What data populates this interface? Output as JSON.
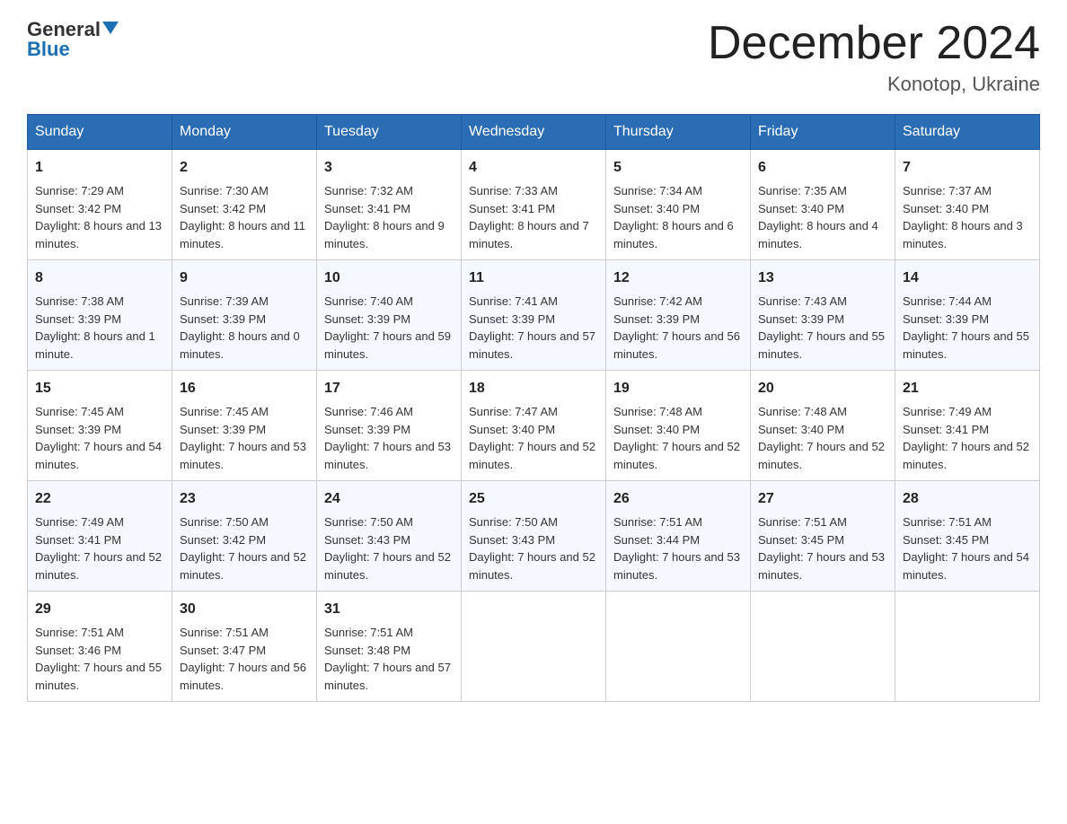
{
  "header": {
    "logo_general": "General",
    "logo_blue": "Blue",
    "month_title": "December 2024",
    "location": "Konotop, Ukraine"
  },
  "days_of_week": [
    "Sunday",
    "Monday",
    "Tuesday",
    "Wednesday",
    "Thursday",
    "Friday",
    "Saturday"
  ],
  "weeks": [
    [
      {
        "day": "1",
        "sunrise": "7:29 AM",
        "sunset": "3:42 PM",
        "daylight": "8 hours and 13 minutes."
      },
      {
        "day": "2",
        "sunrise": "7:30 AM",
        "sunset": "3:42 PM",
        "daylight": "8 hours and 11 minutes."
      },
      {
        "day": "3",
        "sunrise": "7:32 AM",
        "sunset": "3:41 PM",
        "daylight": "8 hours and 9 minutes."
      },
      {
        "day": "4",
        "sunrise": "7:33 AM",
        "sunset": "3:41 PM",
        "daylight": "8 hours and 7 minutes."
      },
      {
        "day": "5",
        "sunrise": "7:34 AM",
        "sunset": "3:40 PM",
        "daylight": "8 hours and 6 minutes."
      },
      {
        "day": "6",
        "sunrise": "7:35 AM",
        "sunset": "3:40 PM",
        "daylight": "8 hours and 4 minutes."
      },
      {
        "day": "7",
        "sunrise": "7:37 AM",
        "sunset": "3:40 PM",
        "daylight": "8 hours and 3 minutes."
      }
    ],
    [
      {
        "day": "8",
        "sunrise": "7:38 AM",
        "sunset": "3:39 PM",
        "daylight": "8 hours and 1 minute."
      },
      {
        "day": "9",
        "sunrise": "7:39 AM",
        "sunset": "3:39 PM",
        "daylight": "8 hours and 0 minutes."
      },
      {
        "day": "10",
        "sunrise": "7:40 AM",
        "sunset": "3:39 PM",
        "daylight": "7 hours and 59 minutes."
      },
      {
        "day": "11",
        "sunrise": "7:41 AM",
        "sunset": "3:39 PM",
        "daylight": "7 hours and 57 minutes."
      },
      {
        "day": "12",
        "sunrise": "7:42 AM",
        "sunset": "3:39 PM",
        "daylight": "7 hours and 56 minutes."
      },
      {
        "day": "13",
        "sunrise": "7:43 AM",
        "sunset": "3:39 PM",
        "daylight": "7 hours and 55 minutes."
      },
      {
        "day": "14",
        "sunrise": "7:44 AM",
        "sunset": "3:39 PM",
        "daylight": "7 hours and 55 minutes."
      }
    ],
    [
      {
        "day": "15",
        "sunrise": "7:45 AM",
        "sunset": "3:39 PM",
        "daylight": "7 hours and 54 minutes."
      },
      {
        "day": "16",
        "sunrise": "7:45 AM",
        "sunset": "3:39 PM",
        "daylight": "7 hours and 53 minutes."
      },
      {
        "day": "17",
        "sunrise": "7:46 AM",
        "sunset": "3:39 PM",
        "daylight": "7 hours and 53 minutes."
      },
      {
        "day": "18",
        "sunrise": "7:47 AM",
        "sunset": "3:40 PM",
        "daylight": "7 hours and 52 minutes."
      },
      {
        "day": "19",
        "sunrise": "7:48 AM",
        "sunset": "3:40 PM",
        "daylight": "7 hours and 52 minutes."
      },
      {
        "day": "20",
        "sunrise": "7:48 AM",
        "sunset": "3:40 PM",
        "daylight": "7 hours and 52 minutes."
      },
      {
        "day": "21",
        "sunrise": "7:49 AM",
        "sunset": "3:41 PM",
        "daylight": "7 hours and 52 minutes."
      }
    ],
    [
      {
        "day": "22",
        "sunrise": "7:49 AM",
        "sunset": "3:41 PM",
        "daylight": "7 hours and 52 minutes."
      },
      {
        "day": "23",
        "sunrise": "7:50 AM",
        "sunset": "3:42 PM",
        "daylight": "7 hours and 52 minutes."
      },
      {
        "day": "24",
        "sunrise": "7:50 AM",
        "sunset": "3:43 PM",
        "daylight": "7 hours and 52 minutes."
      },
      {
        "day": "25",
        "sunrise": "7:50 AM",
        "sunset": "3:43 PM",
        "daylight": "7 hours and 52 minutes."
      },
      {
        "day": "26",
        "sunrise": "7:51 AM",
        "sunset": "3:44 PM",
        "daylight": "7 hours and 53 minutes."
      },
      {
        "day": "27",
        "sunrise": "7:51 AM",
        "sunset": "3:45 PM",
        "daylight": "7 hours and 53 minutes."
      },
      {
        "day": "28",
        "sunrise": "7:51 AM",
        "sunset": "3:45 PM",
        "daylight": "7 hours and 54 minutes."
      }
    ],
    [
      {
        "day": "29",
        "sunrise": "7:51 AM",
        "sunset": "3:46 PM",
        "daylight": "7 hours and 55 minutes."
      },
      {
        "day": "30",
        "sunrise": "7:51 AM",
        "sunset": "3:47 PM",
        "daylight": "7 hours and 56 minutes."
      },
      {
        "day": "31",
        "sunrise": "7:51 AM",
        "sunset": "3:48 PM",
        "daylight": "7 hours and 57 minutes."
      },
      null,
      null,
      null,
      null
    ]
  ],
  "labels": {
    "sunrise": "Sunrise:",
    "sunset": "Sunset:",
    "daylight": "Daylight:"
  }
}
